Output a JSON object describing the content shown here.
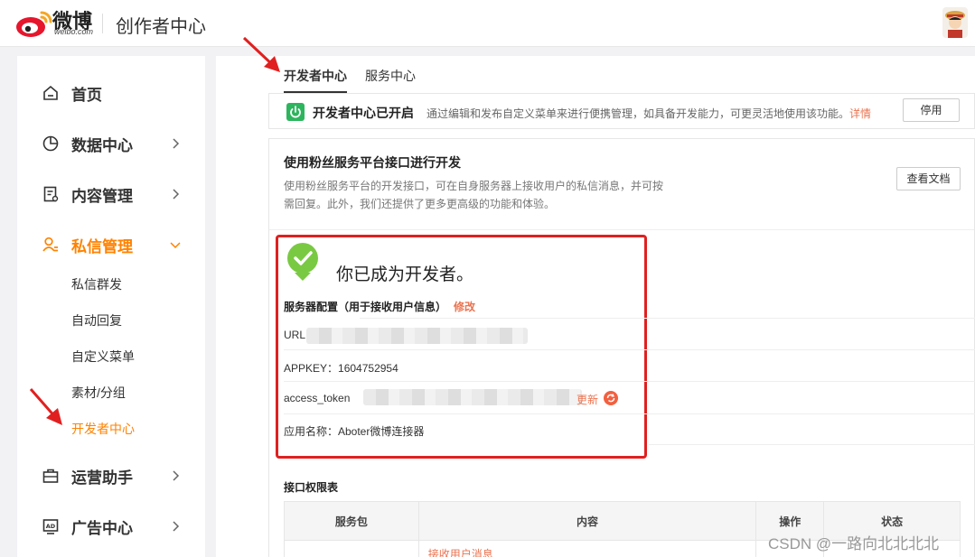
{
  "header": {
    "logo_text": "微博",
    "logo_sub": "weibo.com",
    "title": "创作者中心"
  },
  "sidebar": {
    "items": [
      {
        "label": "首页",
        "icon": "home-icon"
      },
      {
        "label": "数据中心",
        "icon": "pie-chart-icon"
      },
      {
        "label": "内容管理",
        "icon": "document-icon"
      },
      {
        "label": "私信管理",
        "icon": "user-icon"
      },
      {
        "label": "运营助手",
        "icon": "briefcase-icon"
      },
      {
        "label": "广告中心",
        "icon": "ad-icon"
      }
    ],
    "sub_items": [
      "私信群发",
      "自动回复",
      "自定义菜单",
      "素材/分组",
      "开发者中心"
    ]
  },
  "tabs": [
    "开发者中心",
    "服务中心"
  ],
  "status": {
    "title": "开发者中心已开启",
    "desc": "通过编辑和发布自定义菜单来进行便携管理，如具备开发能力，可更灵活地使用该功能。",
    "link": "详情",
    "button": "停用"
  },
  "main": {
    "title": "使用粉丝服务平台接口进行开发",
    "desc": "使用粉丝服务平台的开发接口，可在自身服务器上接收用户的私信消息，并可按需回复。此外，我们还提供了更多更高级的功能和体验。",
    "doc_button": "查看文档"
  },
  "developer": {
    "title": "你已成为开发者。",
    "config_title": "服务器配置（用于接收用户信息）",
    "config_edit": "修改",
    "url_label": "URL",
    "appkey_label": "APPKEY：1604752954",
    "token_label": "access_token",
    "refresh_label": "更新",
    "app_name": "应用名称：Aboter微博连接器"
  },
  "permissions": {
    "title": "接口权限表",
    "columns": [
      "服务包",
      "内容",
      "操作",
      "状态"
    ],
    "first_row_content": "接收用户消息"
  },
  "watermark": "CSDN @一路向北北北北",
  "colors": {
    "accent": "#ff8200",
    "link": "#eb7350",
    "success": "#2db55d",
    "highlight_border": "#e02020"
  }
}
